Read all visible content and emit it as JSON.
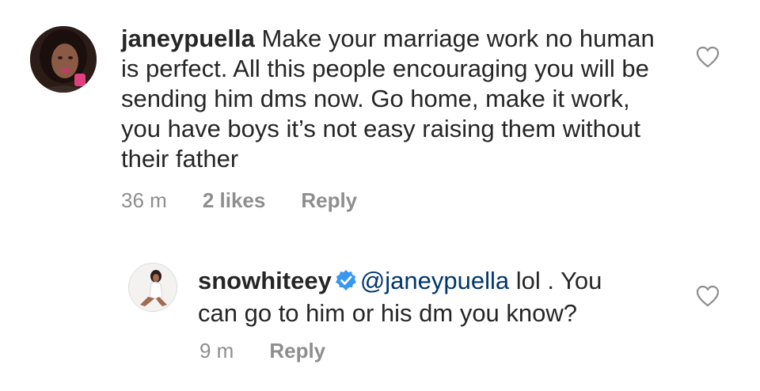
{
  "comments": [
    {
      "username": "janeypuella",
      "text": " Make your marriage work no human is perfect. All this people encouraging you will be sending him dms now. Go home, make it work, you have boys it’s not easy raising them without their father",
      "time": "36 m",
      "likes": "2 likes",
      "reply_label": "Reply",
      "avatar_icon": "user-avatar-icon"
    },
    {
      "username": "snowhiteey",
      "verified": true,
      "mention": "@janeypuella",
      "text": " lol . You can go to him or his dm you know?",
      "time": "9 m",
      "reply_label": "Reply",
      "avatar_icon": "user-avatar-icon"
    }
  ],
  "colors": {
    "text": "#262626",
    "meta": "#8e8e8e",
    "mention": "#00376b",
    "verified": "#3897f0"
  }
}
